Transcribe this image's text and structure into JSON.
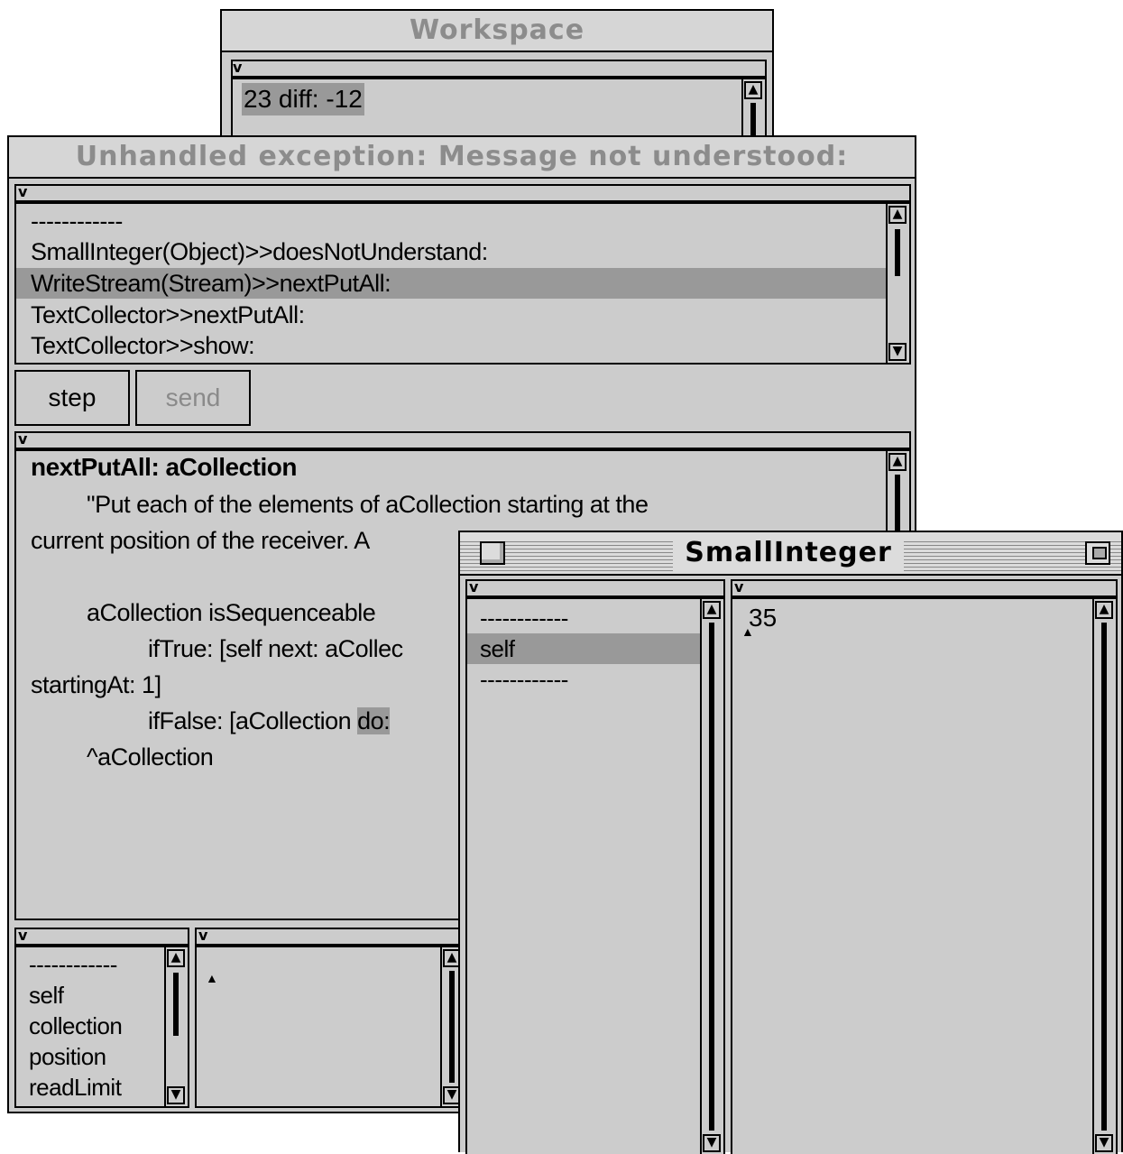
{
  "workspace": {
    "title": "Workspace",
    "menu_glyph": "v",
    "text": "23 diff: -12"
  },
  "debugger": {
    "title": "Unhandled exception: Message not understood:",
    "menu_glyph": "v",
    "stack": [
      "------------",
      "SmallInteger(Object)>>doesNotUnderstand:",
      "WriteStream(Stream)>>nextPutAll:",
      "TextCollector>>nextPutAll:",
      "TextCollector>>show:"
    ],
    "selected_stack_index": 2,
    "buttons": {
      "step": "step",
      "send": "send"
    },
    "code": {
      "header": "nextPutAll: aCollection",
      "line1": "\"Put each of the elements of aCollection starting at the",
      "line2": "current position of the receiver.  A",
      "line3": "aCollection isSequenceable",
      "line4": "ifTrue: [self next: aCollec",
      "line5": "startingAt: 1]",
      "line6_pre": "ifFalse: [aCollection ",
      "line6_hl": "do: ",
      "line7": "^aCollection"
    },
    "vars": [
      "------------",
      "self",
      "collection",
      "position",
      "readLimit"
    ]
  },
  "inspector": {
    "title": "SmallInteger",
    "fields": [
      "------------",
      "self",
      "------------"
    ],
    "selected_field_index": 1,
    "value": "35"
  },
  "glyphs": {
    "up": "▲",
    "down": "▼",
    "caret": "▲"
  }
}
